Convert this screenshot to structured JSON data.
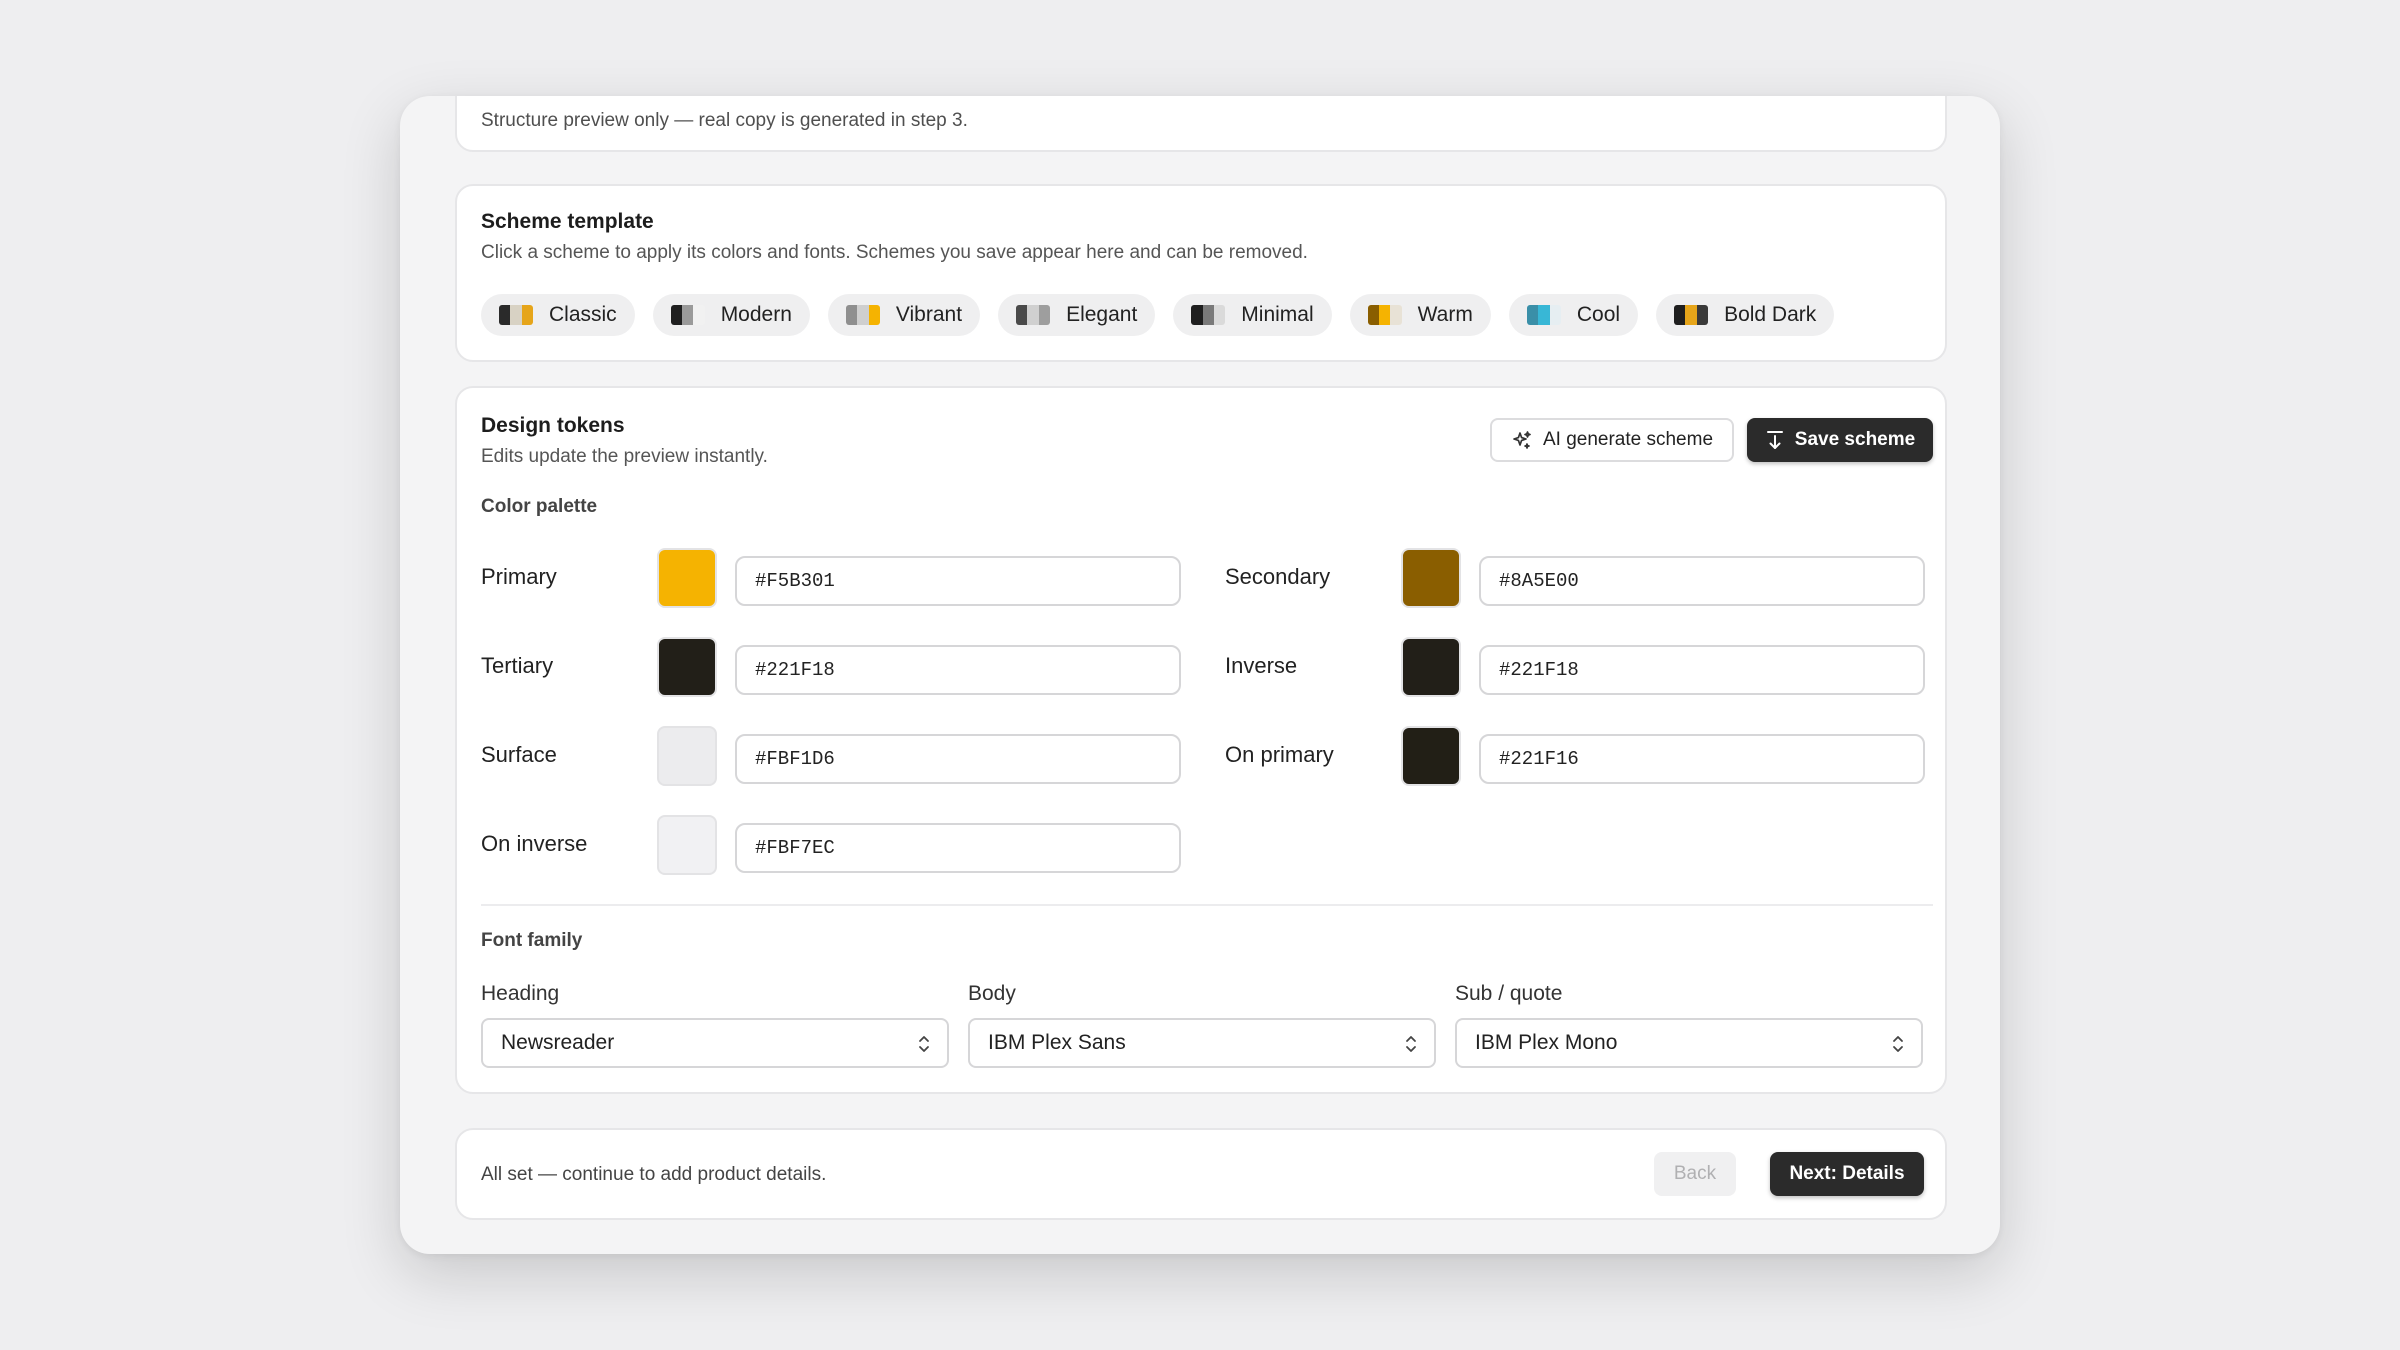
{
  "preview_note": "Structure preview only — real copy is generated in step 3.",
  "scheme": {
    "title": "Scheme template",
    "subtitle": "Click a scheme to apply its colors and fonts. Schemes you save appear here and can be removed.",
    "templates": [
      {
        "name": "Classic",
        "colors": [
          "#2a2a2a",
          "#d8d2c4",
          "#e6a51a"
        ]
      },
      {
        "name": "Modern",
        "colors": [
          "#1f1f1f",
          "#9a9a9a",
          "#f1f1f1"
        ]
      },
      {
        "name": "Vibrant",
        "colors": [
          "#8f8f8f",
          "#cfcfcf",
          "#f5b301"
        ]
      },
      {
        "name": "Elegant",
        "colors": [
          "#4a4a4a",
          "#d0d0d0",
          "#9e9e9e"
        ]
      },
      {
        "name": "Minimal",
        "colors": [
          "#1f1f1f",
          "#7a7a7a",
          "#dadada"
        ]
      },
      {
        "name": "Warm",
        "colors": [
          "#8a5e00",
          "#f5b301",
          "#e8e2d6"
        ]
      },
      {
        "name": "Cool",
        "colors": [
          "#3a8fa8",
          "#38b7d6",
          "#e6eef2"
        ]
      },
      {
        "name": "Bold Dark",
        "colors": [
          "#1f1f1f",
          "#e6a51a",
          "#3a3a3a"
        ]
      }
    ]
  },
  "tokens": {
    "title": "Design tokens",
    "subtitle": "Edits update the preview instantly.",
    "ai_button": "AI generate scheme",
    "save_button": "Save scheme",
    "palette_label": "Color palette",
    "colors": [
      {
        "label": "Primary",
        "value": "#F5B301",
        "swatch": "#F5B301"
      },
      {
        "label": "Secondary",
        "value": "#8A5E00",
        "swatch": "#8A5E00"
      },
      {
        "label": "Tertiary",
        "value": "#221F18",
        "swatch": "#221F18"
      },
      {
        "label": "Inverse",
        "value": "#221F18",
        "swatch": "#221F18"
      },
      {
        "label": "Surface",
        "value": "#FBF1D6",
        "swatch": "#ececee"
      },
      {
        "label": "On primary",
        "value": "#221F16",
        "swatch": "#221F16"
      },
      {
        "label": "On inverse",
        "value": "#FBF7EC",
        "swatch": "#f1f1f3"
      }
    ],
    "font_label": "Font family",
    "fonts": [
      {
        "label": "Heading",
        "value": "Newsreader"
      },
      {
        "label": "Body",
        "value": "IBM Plex Sans"
      },
      {
        "label": "Sub / quote",
        "value": "IBM Plex Mono"
      }
    ]
  },
  "footer": {
    "note": "All set — continue to add product details.",
    "back": "Back",
    "next": "Next: Details"
  }
}
